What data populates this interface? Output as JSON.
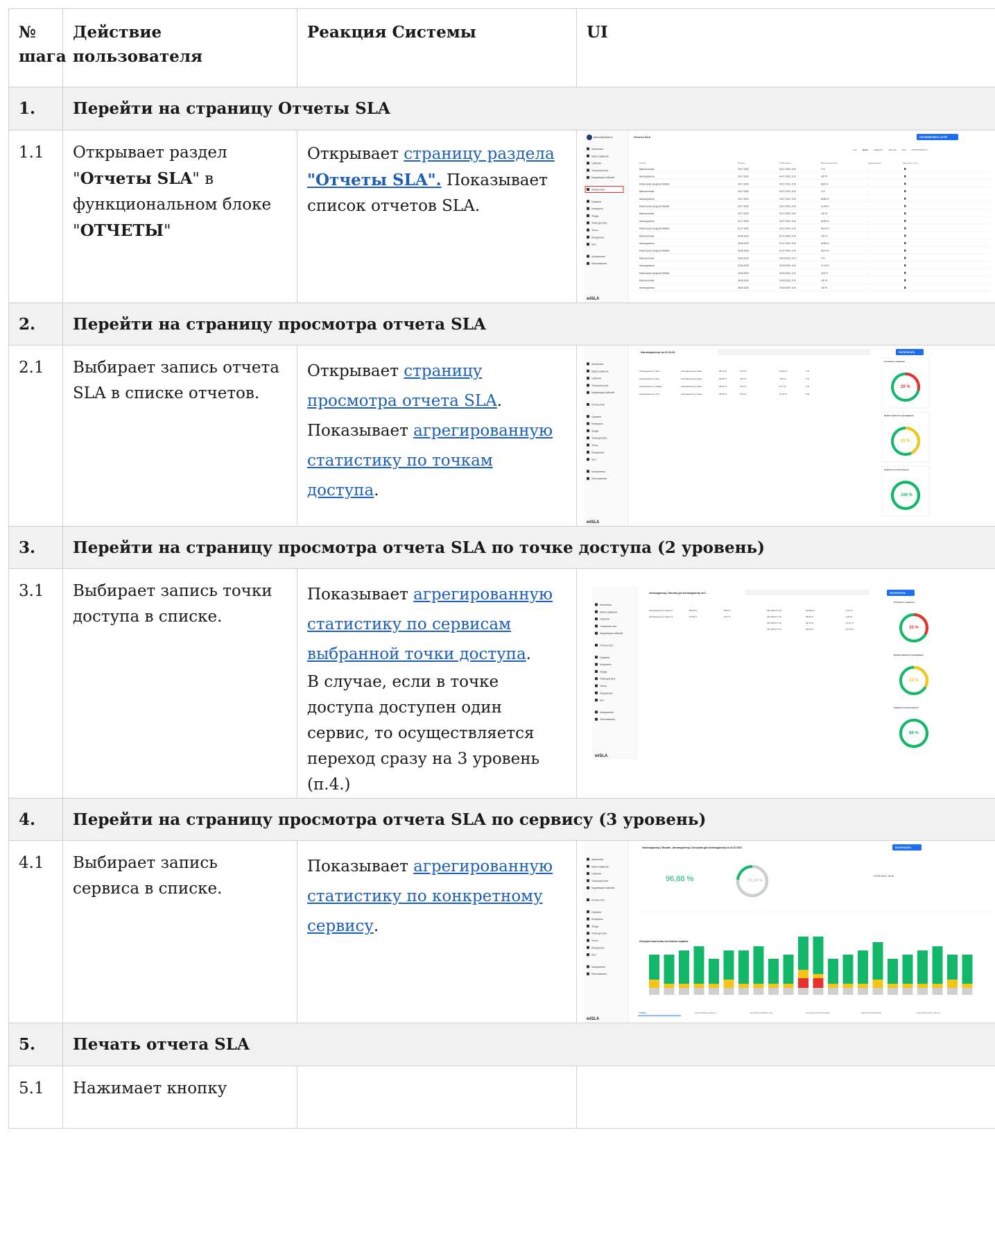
{
  "header": {
    "num": "№ шага",
    "action": "Действие пользователя",
    "reaction": "Реакция Системы",
    "ui": "UI"
  },
  "steps": [
    {
      "num": "1.",
      "title": "Перейти на страницу Отчеты SLA"
    },
    {
      "num": "2.",
      "title": "Перейти на страницу просмотра отчета SLA"
    },
    {
      "num": "3.",
      "title": "Перейти на страницу просмотра отчета SLA по точке доступа (2 уровень)"
    },
    {
      "num": "4.",
      "title": "Перейти на страницу просмотра отчета SLA по сервису (3 уровень)"
    },
    {
      "num": "5.",
      "title": "Печать отчета SLA"
    }
  ],
  "rows": {
    "r11": {
      "num": "1.1",
      "action_a": "Открывает раздел \"",
      "action_b": "Отчеты SLA",
      "action_c": "\" в функциональном блоке \"",
      "action_d": "ОТЧЕТЫ",
      "action_e": "\"",
      "reaction_a": "Открывает ",
      "reaction_link1": "страницу раздела",
      "reaction_link2": "\"Отчеты SLA\".",
      "reaction_b": " Показывает список отчетов SLA."
    },
    "r21": {
      "num": "2.1",
      "action": "Выбирает запись отчета SLA в списке отчетов.",
      "reaction_a": "Открывает ",
      "reaction_link1": "страницу просмотра отчета SLA",
      "reaction_b": ". Показывает ",
      "reaction_link2": "агрегированную статистику по точкам доступа",
      "reaction_c": "."
    },
    "r31": {
      "num": "3.1",
      "action": "Выбирает запись точки доступа в списке.",
      "reaction_a": "Показывает ",
      "reaction_link1": "агрегированную статистику по сервисам выбранной точки доступа",
      "reaction_b": ".",
      "reaction_note": "В случае, если в точке доступа доступен один сервис, то осуществляется переход сразу на 3 уровень (п.4.)"
    },
    "r41": {
      "num": "4.1",
      "action": "Выбирает запись сервиса в списке.",
      "reaction_a": "Показывает ",
      "reaction_link1": "агрегированную статистику по конкретному сервису",
      "reaction_b": "."
    },
    "r51": {
      "num": "5.1",
      "action": "Нажимает кнопку"
    }
  },
  "shots": {
    "s1": {
      "title": "Отчеты SLA",
      "user": "aikulov@wellink.ru",
      "button": "СФОРМИРОВАТЬ ОТЧЁТ",
      "brand": "wiSLA",
      "menu": [
        "Аналитика",
        "Карта сервисов",
        "События",
        "Топология сети",
        "Корреляция событий",
        "Отчеты SLA",
        "Сервисы",
        "Контракты",
        "Зонды",
        "Точки доступа",
        "Тесты",
        "Показатели",
        "SLA",
        "Контрагенты",
        "Пользователи"
      ],
      "periods": [
        "ЧАС",
        "ДЕНЬ",
        "НЕДЕЛЯ",
        "МЕСЯЦ",
        "ВСЁ",
        "ПРОИЗВОЛЬНО"
      ],
      "cols": [
        "Клиент",
        "Период",
        "Публикация",
        "Выполнение SLA",
        "Компенсация",
        "Загрузить отчет"
      ],
      "rows": [
        [
          "Miranda-media",
          "03.07.2023",
          "04.07.2023, 0:10",
          "0 %"
        ],
        [
          "Автокорректор",
          "03.07.2023",
          "04.07.2023, 0:10",
          "100 %"
        ],
        [
          "Мониторинг ресурсов Wellink",
          "03.07.2023",
          "04.07.2023, 0:10",
          "83,9 %"
        ],
        [
          "Miranda-media",
          "02.07.2023",
          "03.07.2023, 0:10",
          "0 %"
        ],
        [
          "Автокорректор",
          "02.07.2023",
          "03.07.2023, 0:10",
          "82,86 %"
        ],
        [
          "Мониторинг ресурсов Wellink",
          "02.07.2023",
          "03.07.2023, 0:10",
          "41,48 %"
        ],
        [
          "Miranda-media",
          "01.07.2023",
          "02.07.2023, 0:10",
          "100 %"
        ],
        [
          "Автокорректор",
          "01.07.2023",
          "02.07.2023, 0:10",
          "82,86 %"
        ],
        [
          "Мониторинг ресурсов Wellink",
          "01.07.2023",
          "02.07.2023, 0:10",
          "90,24 %"
        ],
        [
          "Miranda-media",
          "30.06.2023",
          "01.07.2023, 0:10",
          "100 %"
        ],
        [
          "Автокорректор",
          "30.06.2023",
          "01.07.2023, 0:10",
          "82,86 %"
        ],
        [
          "Мониторинг ресурсов Wellink",
          "30.06.2023",
          "01.07.2023, 0:10",
          "90,24 %"
        ],
        [
          "Miranda-media",
          "29.06.2023",
          "30.06.2023, 0:10",
          "0 %"
        ],
        [
          "Автокорректор",
          "29.06.2023",
          "30.06.2023, 0:10",
          "71,43 %"
        ],
        [
          "Мониторинг ресурсов Wellink",
          "29.06.2023",
          "30.06.2023, 0:10",
          "43,9 %"
        ],
        [
          "Miranda-media",
          "28.06.2023",
          "29.06.2023, 0:10",
          "100 %"
        ],
        [
          "Автокорректор",
          "28.06.2023",
          "29.06.2023, 0:10",
          "100 %"
        ]
      ]
    },
    "s2": {
      "title": "Автокорректор за 22.10.23",
      "button": "РАСПЕЧАТАТЬ",
      "brand": "wiSLA",
      "rows": [
        [
          "Автокорректор | Мон...",
          "96,79 %",
          "6,17 %",
          "15,83 %"
        ],
        [
          "Автокорректор | Екат...",
          "96,85 %",
          "3,67 %",
          "7,29 %"
        ],
        [
          "Автокорректор | Казань",
          "96,84 %",
          "3,67 %",
          "8,77 %"
        ],
        [
          "Автокорректор | Кост...",
          "96,53 %",
          "5,44 %",
          "13,42 %"
        ]
      ],
      "cards": [
        {
          "title": "Готовность сервисов",
          "value": "29 %"
        },
        {
          "title": "Время сервисов в деградации",
          "value": "43 %"
        },
        {
          "title": "Сервисы на мониторинге",
          "value": "100 %"
        }
      ]
    },
    "s3": {
      "title": "Автокорректор | Москва для Автокорректор за 2...",
      "button": "РАСПЕЧАТАТЬ",
      "brand": "wiSLA",
      "rows": [
        [
          "Автокорректор | Канал 3...",
          "96,83 %",
          "6,84 %"
        ],
        [
          "Автокорректор | Канал 3...",
          "97,82 %",
          "5,47 %"
        ]
      ],
      "ips": [
        [
          "192.168.177.15",
          "100,00 %",
          "2,47 %"
        ],
        [
          "192.168.177.16",
          "96,84 %",
          "6,94 %"
        ],
        [
          "192.168.177.16",
          "93,75 %",
          "13,07 %"
        ],
        [
          "192.168.177.15",
          "93,83 %",
          "13,15 %"
        ]
      ],
      "cards": [
        {
          "title": "Готовность сервисов",
          "value": "33 %"
        },
        {
          "title": "Время сервисов в деградации",
          "value": "33 %"
        },
        {
          "title": "Сервисы на мониторинге",
          "value": "86 %"
        }
      ]
    },
    "s4": {
      "title": "Автокорректор | Москва - Автокорректор | Кострома для Автокорректор за 23.10.2023",
      "button": "РАСПЕЧАТАТЬ",
      "brand": "wiSLA",
      "availability": "96,88 %",
      "donut": "76,39 %",
      "date": "23.03.2023, 16:40",
      "chart_title": "История изменения состояния сервиса",
      "tabs": [
        "ОТКАЗ",
        "ПЛАНОВЫЕ РАБОТЫ",
        "НЕ ОБСЛУЖИВАЕТСЯ",
        "РУЧНОЕ ИСКЛЮЧЕНИЕ",
        "АВТОИСКЛЮЧЕНИЕ",
        "НАГРУЗОЧНЫЕ ТЕСТЫ"
      ]
    }
  },
  "colors": {
    "green": "#12b76a",
    "yellow": "#f5c518",
    "red": "#e5312f",
    "blue": "#1d6ef0",
    "link": "#1c5fb3"
  }
}
